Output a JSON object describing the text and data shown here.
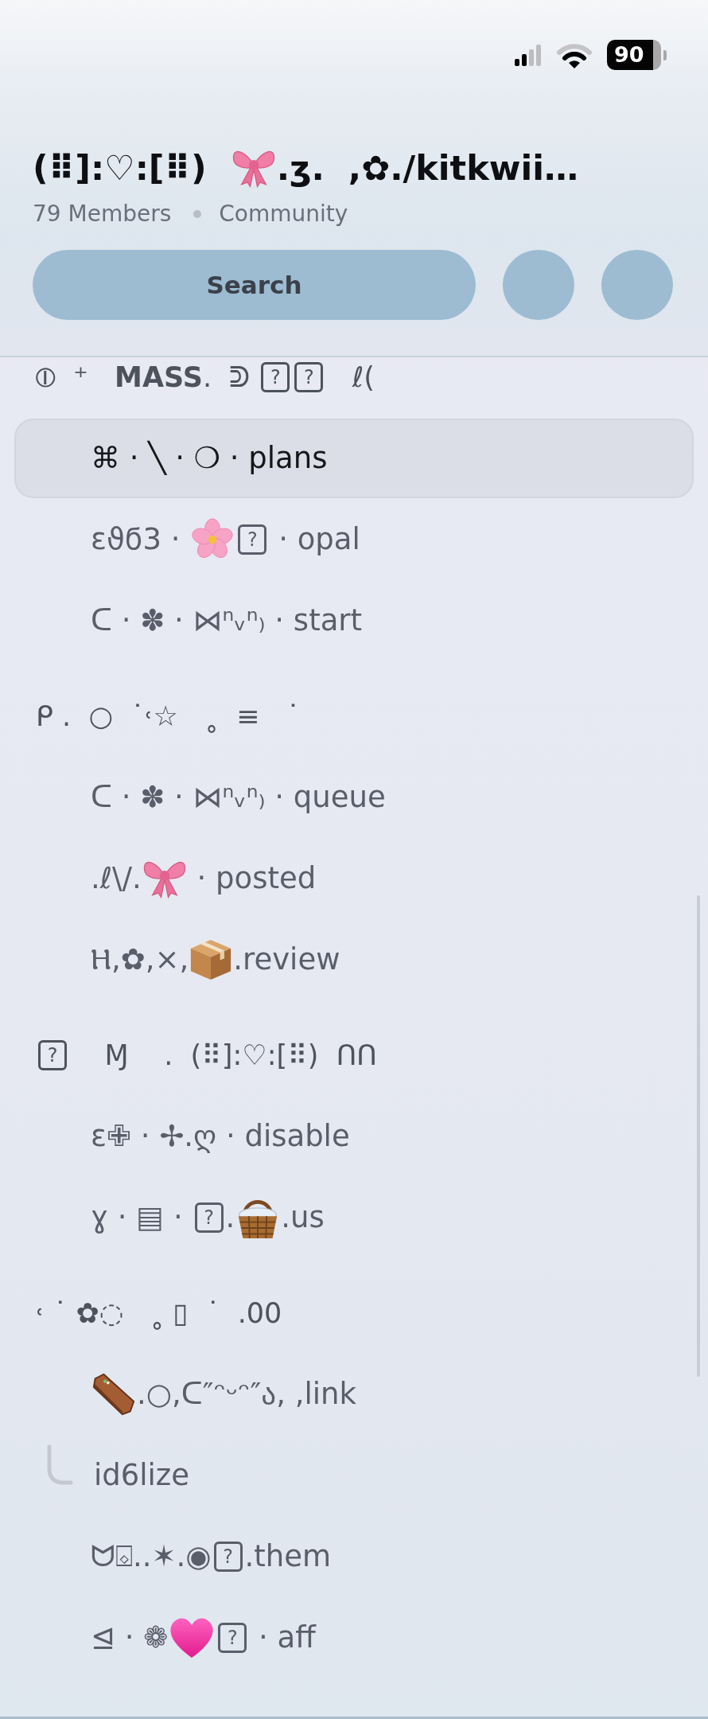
{
  "status_bar": {
    "battery": "90"
  },
  "server": {
    "title": [
      {
        "kind": "text",
        "text": "(⠿]:♡:[⠿)  "
      },
      {
        "kind": "bow"
      },
      {
        "kind": "text",
        "text": ".ʒ.  ,✿./kitkwii…"
      }
    ],
    "members": "79 Members",
    "type": "Community"
  },
  "search": {
    "label": "Search"
  },
  "categories": [
    {
      "title": [
        {
          "kind": "text",
          "text": "⦶  ⁺   **MASS**.  ᕲ "
        },
        {
          "kind": "tofu",
          "text": "?"
        },
        {
          "kind": "tofu",
          "text": "?"
        },
        {
          "kind": "text",
          "text": "   ℓ("
        }
      ],
      "channels": [
        {
          "name": [
            {
              "kind": "text",
              "text": "⌘ · ╲ · ❍ · plans"
            }
          ],
          "selected": true
        },
        {
          "name": [
            {
              "kind": "text",
              "text": "ɛϑϭ3 · "
            },
            {
              "kind": "blossom"
            },
            {
              "kind": "tofu",
              "text": "?"
            },
            {
              "kind": "text",
              "text": " · opal"
            }
          ],
          "selected": false
        },
        {
          "name": [
            {
              "kind": "text",
              "text": "ᑕ · ✽ · ⋈ⁿᵥⁿ₎ · start"
            }
          ],
          "selected": false
        }
      ]
    },
    {
      "title": [
        {
          "kind": "text",
          "text": "ᑭ .  ○  ˙˓☆   ˳  ≡   ˙"
        }
      ],
      "channels": [
        {
          "name": [
            {
              "kind": "text",
              "text": "ᑕ · ✽ · ⋈ⁿᵥⁿ₎ · queue"
            }
          ],
          "selected": false
        },
        {
          "name": [
            {
              "kind": "text",
              "text": ".ℓ\\/."
            },
            {
              "kind": "bow"
            },
            {
              "kind": "text",
              "text": " · posted"
            }
          ],
          "selected": false
        },
        {
          "name": [
            {
              "kind": "text",
              "text": "Ⲏ,✿,×,"
            },
            {
              "kind": "box"
            },
            {
              "kind": "text",
              "text": ".review"
            }
          ],
          "selected": false
        }
      ]
    },
    {
      "title": [
        {
          "kind": "tofu",
          "text": "?"
        },
        {
          "kind": "text",
          "text": "    Ɱ    .  (⠿]:♡:[⠿)  ᑎᑎ"
        }
      ],
      "channels": [
        {
          "name": [
            {
              "kind": "text",
              "text": "ɛ✙ · ✢.ღ · disable"
            }
          ],
          "selected": false
        },
        {
          "name": [
            {
              "kind": "text",
              "text": "ɣ · ▤ · "
            },
            {
              "kind": "tofu",
              "text": "?"
            },
            {
              "kind": "text",
              "text": "."
            },
            {
              "kind": "basket"
            },
            {
              "kind": "text",
              "text": ".us"
            }
          ],
          "selected": false
        }
      ]
    },
    {
      "title": [
        {
          "kind": "text",
          "text": "˓ ˙ ✿◌   ˳ ▯  ˙  .00"
        }
      ],
      "channels": [
        {
          "name": [
            {
              "kind": "coffin"
            },
            {
              "kind": "text",
              "text": ".○,ᑕ″ᵔᵕᵔ″ა, ,link"
            }
          ],
          "selected": false,
          "children": [
            {
              "name": [
                {
                  "kind": "text",
                  "text": "id6lize"
                }
              ],
              "selected": false
            }
          ]
        },
        {
          "name": [
            {
              "kind": "text",
              "text": "ᗢ⌺..✶.◉"
            },
            {
              "kind": "tofu",
              "text": "?"
            },
            {
              "kind": "text",
              "text": ".them"
            }
          ],
          "selected": false
        },
        {
          "name": [
            {
              "kind": "text",
              "text": "⊴ · ❁"
            },
            {
              "kind": "heart"
            },
            {
              "kind": "tofu",
              "text": "?"
            },
            {
              "kind": "text",
              "text": " · aff"
            }
          ],
          "selected": false
        }
      ]
    }
  ]
}
